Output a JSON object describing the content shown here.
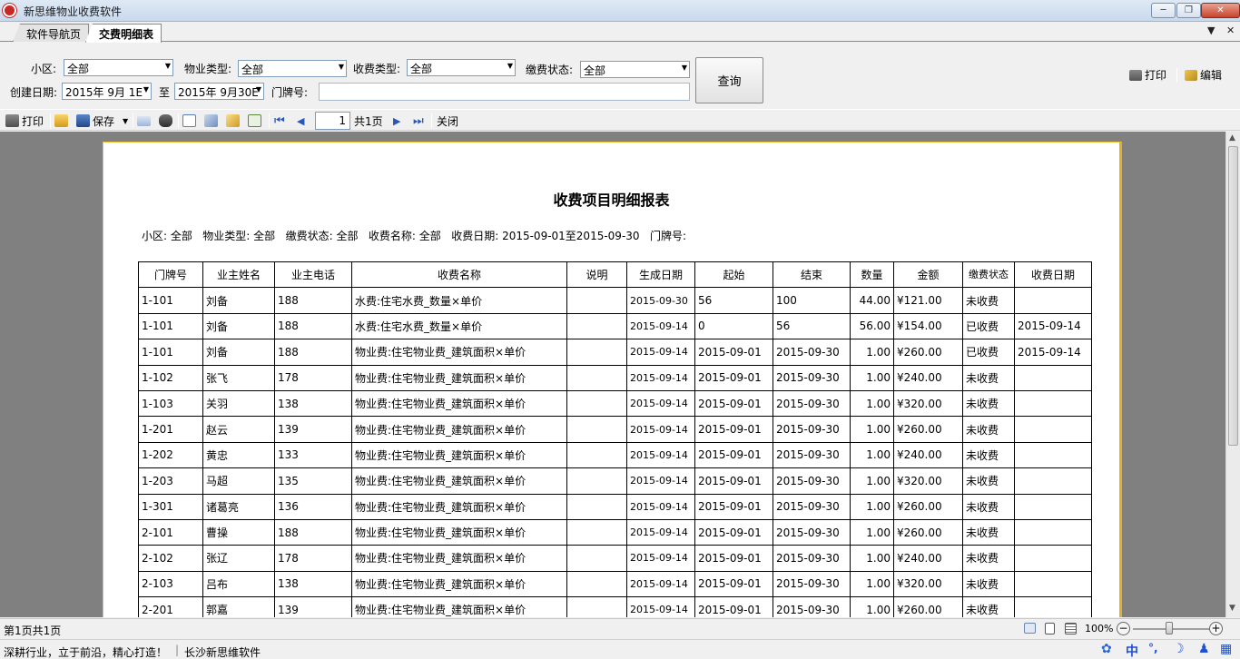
{
  "window": {
    "title": "新思维物业收费软件",
    "min_icon": "minimize-icon",
    "max_icon": "restore-icon",
    "close_label": "✕"
  },
  "tabs": [
    {
      "label": "软件导航页"
    },
    {
      "label": "交费明细表"
    }
  ],
  "filters": {
    "community_label": "小区:",
    "community_value": "全部",
    "property_type_label": "物业类型:",
    "property_type_value": "全部",
    "fee_type_label": "收费类型:",
    "fee_type_value": "全部",
    "pay_status_label": "缴费状态:",
    "pay_status_value": "全部",
    "create_date_label": "创建日期:",
    "date_from": "2015年 9月 1E",
    "date_to_label": "至",
    "date_to": "2015年 9月30E",
    "door_no_label": "门牌号:",
    "door_no_value": "",
    "query_label": "查询"
  },
  "top_right": {
    "print_label": "打印",
    "edit_label": "编辑"
  },
  "toolbar": {
    "print_label": "打印",
    "save_label": "保存",
    "page_input": "1",
    "total_pages": "共1页",
    "close_label": "关闭"
  },
  "report": {
    "title": "收费项目明细报表",
    "meta": "小区: 全部   物业类型: 全部   缴费状态: 全部   收费名称: 全部   收费日期: 2015-09-01至2015-09-30   门牌号:",
    "columns": [
      "门牌号",
      "业主姓名",
      "业主电话",
      "收费名称",
      "说明",
      "生成日期",
      "起始",
      "结束",
      "数量",
      "金额",
      "缴费状态",
      "收费日期"
    ],
    "rows": [
      [
        "1-101",
        "刘备",
        "188",
        "水费:住宅水费_数量×单价",
        "",
        "2015-09-30",
        "56",
        "100",
        "44.00",
        "¥121.00",
        "未收费",
        ""
      ],
      [
        "1-101",
        "刘备",
        "188",
        "水费:住宅水费_数量×单价",
        "",
        "2015-09-14",
        "0",
        "56",
        "56.00",
        "¥154.00",
        "已收费",
        "2015-09-14"
      ],
      [
        "1-101",
        "刘备",
        "188",
        "物业费:住宅物业费_建筑面积×单价",
        "",
        "2015-09-14",
        "2015-09-01",
        "2015-09-30",
        "1.00",
        "¥260.00",
        "已收费",
        "2015-09-14"
      ],
      [
        "1-102",
        "张飞",
        "178",
        "物业费:住宅物业费_建筑面积×单价",
        "",
        "2015-09-14",
        "2015-09-01",
        "2015-09-30",
        "1.00",
        "¥240.00",
        "未收费",
        ""
      ],
      [
        "1-103",
        "关羽",
        "138",
        "物业费:住宅物业费_建筑面积×单价",
        "",
        "2015-09-14",
        "2015-09-01",
        "2015-09-30",
        "1.00",
        "¥320.00",
        "未收费",
        ""
      ],
      [
        "1-201",
        "赵云",
        "139",
        "物业费:住宅物业费_建筑面积×单价",
        "",
        "2015-09-14",
        "2015-09-01",
        "2015-09-30",
        "1.00",
        "¥260.00",
        "未收费",
        ""
      ],
      [
        "1-202",
        "黄忠",
        "133",
        "物业费:住宅物业费_建筑面积×单价",
        "",
        "2015-09-14",
        "2015-09-01",
        "2015-09-30",
        "1.00",
        "¥240.00",
        "未收费",
        ""
      ],
      [
        "1-203",
        "马超",
        "135",
        "物业费:住宅物业费_建筑面积×单价",
        "",
        "2015-09-14",
        "2015-09-01",
        "2015-09-30",
        "1.00",
        "¥320.00",
        "未收费",
        ""
      ],
      [
        "1-301",
        "诸葛亮",
        "136",
        "物业费:住宅物业费_建筑面积×单价",
        "",
        "2015-09-14",
        "2015-09-01",
        "2015-09-30",
        "1.00",
        "¥260.00",
        "未收费",
        ""
      ],
      [
        "2-101",
        "曹操",
        "188",
        "物业费:住宅物业费_建筑面积×单价",
        "",
        "2015-09-14",
        "2015-09-01",
        "2015-09-30",
        "1.00",
        "¥260.00",
        "未收费",
        ""
      ],
      [
        "2-102",
        "张辽",
        "178",
        "物业费:住宅物业费_建筑面积×单价",
        "",
        "2015-09-14",
        "2015-09-01",
        "2015-09-30",
        "1.00",
        "¥240.00",
        "未收费",
        ""
      ],
      [
        "2-103",
        "吕布",
        "138",
        "物业费:住宅物业费_建筑面积×单价",
        "",
        "2015-09-14",
        "2015-09-01",
        "2015-09-30",
        "1.00",
        "¥320.00",
        "未收费",
        ""
      ],
      [
        "2-201",
        "郭嘉",
        "139",
        "物业费:住宅物业费_建筑面积×单价",
        "",
        "2015-09-14",
        "2015-09-01",
        "2015-09-30",
        "1.00",
        "¥260.00",
        "未收费",
        ""
      ]
    ]
  },
  "status": {
    "page_info": "第1页共1页",
    "zoom": "100%",
    "slogan": "深耕行业，立于前沿，精心打造！",
    "company": "长沙新思维软件"
  },
  "ime": {
    "lang": "中",
    "punct": "°,",
    "moon": "☽"
  },
  "colors": {
    "preview_bg": "#808080",
    "paper_border": "#f2c12e",
    "close_btn": "#c8432b"
  }
}
